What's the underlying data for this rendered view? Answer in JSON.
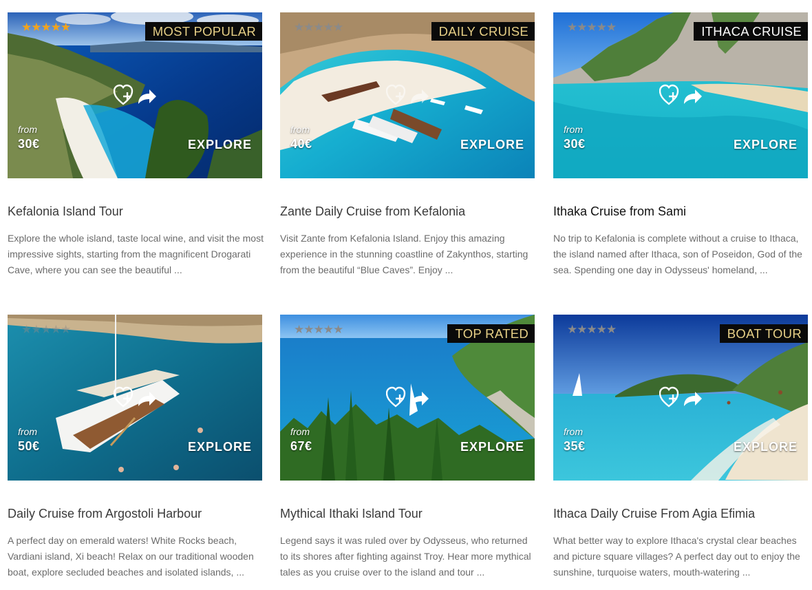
{
  "tours": [
    {
      "title": "Kefalonia Island Tour",
      "description": "Explore the whole island, taste local wine, and visit the most impressive sights, starting from the magnificent Drogarati Cave, where you can see the beautiful ...",
      "badge": "MOST POPULAR",
      "rating": "★★★★★",
      "from_label": "from",
      "price": "30€",
      "explore_label": "EXPLORE"
    },
    {
      "title": "Zante Daily Cruise from Kefalonia",
      "description": "Visit Zante from Kefalonia Island. Enjoy this amazing experience in the stunning coastline of Zakynthos, starting from the beautiful “Blue Caves”. Enjoy ...",
      "badge": "DAILY CRUISE",
      "rating": "★★★★★",
      "from_label": "from",
      "price": "40€",
      "explore_label": "EXPLORE"
    },
    {
      "title": "Ithaka Cruise from Sami",
      "description": "No trip to Kefalonia is complete without a cruise to Ithaca, the island named after Ithaca, son of Poseidon, God of the sea. Spending one day in Odysseus' homeland, ...",
      "badge": "ITHACA CRUISE",
      "rating": "★★★★★",
      "from_label": "from",
      "price": "30€",
      "explore_label": "EXPLORE"
    },
    {
      "title": "Daily Cruise from Argostoli Harbour",
      "description": "A perfect day on emerald waters! White Rocks beach, Vardiani island, Xi beach! Relax on our traditional wooden boat, explore secluded beaches and isolated islands, ...",
      "badge": "",
      "rating": "★★★★★",
      "from_label": "from",
      "price": "50€",
      "explore_label": "EXPLORE"
    },
    {
      "title": "Mythical Ithaki Island Tour",
      "description": "Legend says it was ruled over by Odysseus, who returned to its shores after fighting against Troy. Hear more mythical tales as you cruise over to the island and tour ...",
      "badge": "TOP RATED",
      "rating": "★★★★★",
      "from_label": "from",
      "price": "67€",
      "explore_label": "EXPLORE"
    },
    {
      "title": "Ithaca Daily Cruise From Agia Efimia",
      "description": "What better way to explore Ithaca's crystal clear beaches and picture square villages? A perfect day out to enjoy the sunshine, turquoise waters, mouth-watering ...",
      "badge": "BOAT TOUR",
      "rating": "★★★★★",
      "from_label": "from",
      "price": "35€",
      "explore_label": "EXPLORE"
    }
  ],
  "colors": {
    "badge_bg": "#0a0a0a",
    "badge_text_gold": "#e6cf86",
    "badge_text_white": "#ffffff",
    "star_gold": "#f2a31c",
    "star_grey": "#8a8a8a",
    "title_text": "#3a3a3a",
    "description_text": "#6b6b6b"
  },
  "icons": {
    "favorite": "heart-plus-icon",
    "share": "share-arrow-icon",
    "rating": "star-icon"
  }
}
